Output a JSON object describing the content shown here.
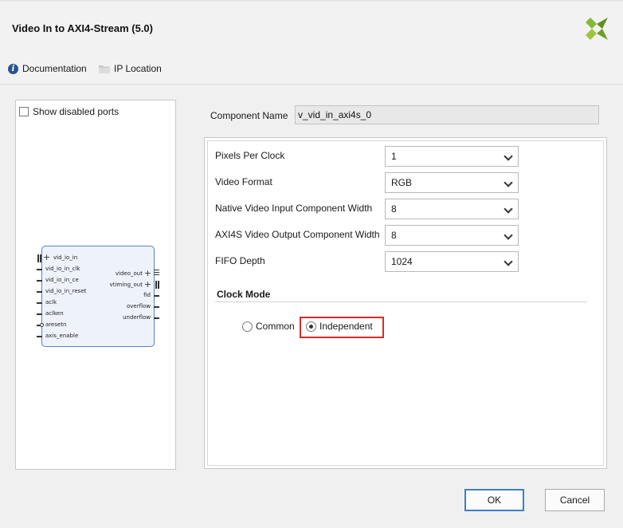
{
  "window": {
    "title": "Video In to AXI4-Stream (5.0)"
  },
  "links": {
    "documentation": "Documentation",
    "ip_location": "IP Location"
  },
  "left_panel": {
    "show_disabled_ports": "Show disabled ports",
    "block": {
      "left_ports": [
        "vid_io_in",
        "vid_io_in_clk",
        "vid_io_in_ce",
        "vid_io_in_reset",
        "aclk",
        "aclken",
        "aresetn",
        "axis_enable"
      ],
      "right_ports": [
        "video_out",
        "vtiming_out",
        "fid",
        "overflow",
        "underflow"
      ]
    }
  },
  "component": {
    "label": "Component Name",
    "value": "v_vid_in_axi4s_0"
  },
  "params": [
    {
      "label": "Pixels Per Clock",
      "value": "1"
    },
    {
      "label": "Video Format",
      "value": "RGB"
    },
    {
      "label": "Native Video Input Component Width",
      "value": "8"
    },
    {
      "label": "AXI4S Video Output Component Width",
      "value": "8"
    },
    {
      "label": "FIFO Depth",
      "value": "1024"
    }
  ],
  "clock_mode": {
    "title": "Clock Mode",
    "options": [
      "Common",
      "Independent"
    ],
    "selected": "Independent"
  },
  "buttons": {
    "ok": "OK",
    "cancel": "Cancel"
  },
  "colors": {
    "highlight": "#d92b2b",
    "ok_border": "#3c7fd1",
    "logo": "#7aaa2a"
  }
}
